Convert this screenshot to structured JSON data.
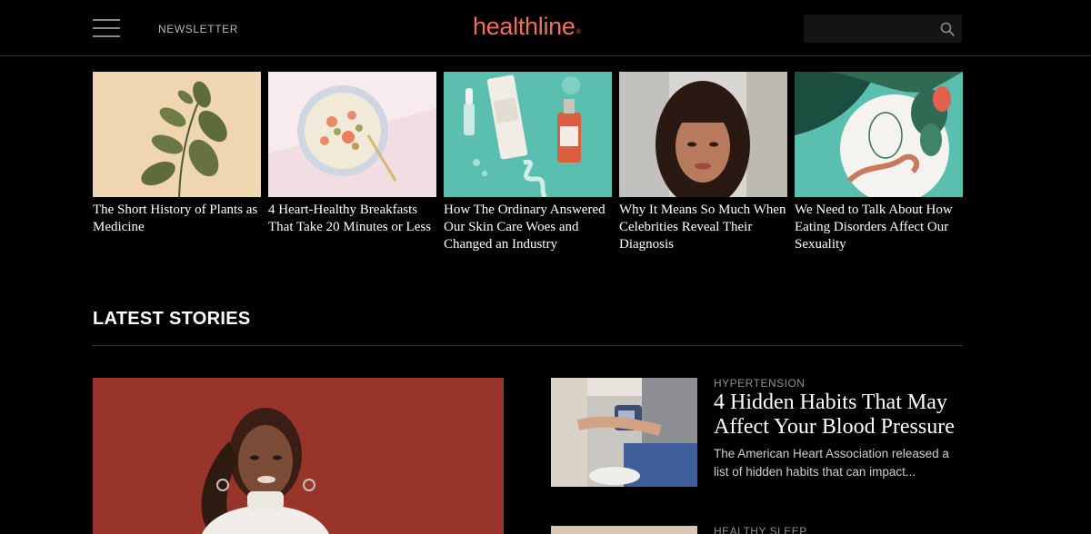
{
  "header": {
    "newsletter_label": "NEWSLETTER",
    "logo_text": "healthline",
    "logo_mark": "®",
    "search_placeholder": "",
    "brand_color": "#e8735a"
  },
  "carousel": [
    {
      "title": "The Short History of Plants as Medicine"
    },
    {
      "title": "4 Heart-Healthy Breakfasts That Take 20 Minutes or Less"
    },
    {
      "title": "How The Ordinary Answered Our Skin Care Woes and Changed an Industry"
    },
    {
      "title": "Why It Means So Much When Celebrities Reveal Their Diagnosis"
    },
    {
      "title": "We Need to Talk About How Eating Disorders Affect Our Sexuality"
    }
  ],
  "latest": {
    "heading": "LATEST STORIES",
    "stories": [
      {
        "category": "HYPERTENSION",
        "title": "4 Hidden Habits That May Affect Your Blood Pressure",
        "description": "The American Heart Association released a list of hidden habits that can impact..."
      },
      {
        "category": "HEALTHY SLEEP"
      }
    ]
  },
  "icons": {
    "menu": "hamburger-menu-icon",
    "search": "search-icon"
  }
}
